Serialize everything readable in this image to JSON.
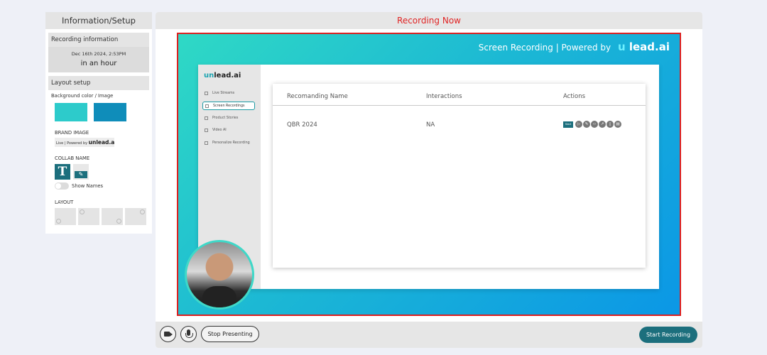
{
  "left_panel": {
    "title": "Information/Setup",
    "recording_info": {
      "header": "Recording information",
      "date": "Dec 16th 2024, 2:53PM",
      "when": "in an hour"
    },
    "layout_setup": {
      "header": "Layout setup",
      "bg_label": "Background color / Image",
      "swatches": [
        "#2dcbcb",
        "#0f8dba"
      ],
      "brand_label": "BRAND IMAGE",
      "brand_chip_text": "Live | Powered by",
      "brand_chip_logo": "unlead.ai",
      "collab_label": "COLLAB NAME",
      "text_button": "T",
      "show_names": "Show Names",
      "layout_label": "LAYOUT"
    }
  },
  "main": {
    "header": "Recording Now",
    "stage": {
      "brand_text": "Screen Recording | Powered by",
      "brand_logo_u": "u",
      "brand_logo": "lead.ai"
    },
    "inner_app": {
      "logo_u": "un",
      "logo": "lead.ai",
      "nav": [
        {
          "label": "Live Streams",
          "icon": "stream-icon"
        },
        {
          "label": "Screen Recordings",
          "icon": "camera-icon"
        },
        {
          "label": "Product Stories",
          "icon": "video-icon"
        },
        {
          "label": "Video AI",
          "icon": "home-icon"
        },
        {
          "label": "Personalize Recording",
          "icon": "settings-icon"
        }
      ],
      "table": {
        "headers": [
          "Recomanding Name",
          "Interactions",
          "Actions"
        ],
        "rows": [
          {
            "name": "QBR 2024",
            "interactions": "NA",
            "start_label": "Start"
          }
        ]
      }
    }
  },
  "bottom_bar": {
    "stop_label": "Stop Presenting",
    "start_label": "Start Recording"
  },
  "colors": {
    "accent": "#1c6f7d",
    "recording_red": "#e02424",
    "stage_gradient_start": "#2fd9c5",
    "stage_gradient_end": "#0b97e6"
  }
}
